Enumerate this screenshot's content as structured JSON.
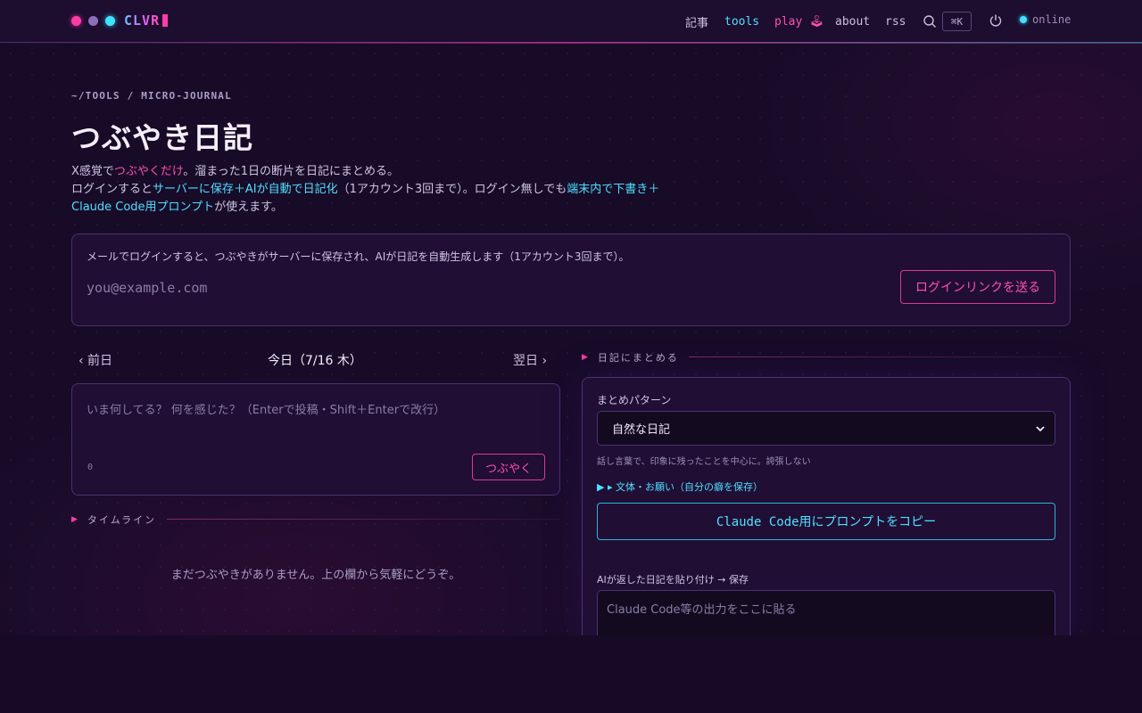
{
  "nav": {
    "logo": "CLVR",
    "articles": "記事",
    "tools": "tools",
    "play": "play 🕹",
    "about": "about",
    "rss": "rss",
    "search_shortcut": "⌘K",
    "status": "online",
    "icons": [
      "search-icon",
      "power-icon"
    ]
  },
  "header": {
    "breadcrumb": "~/TOOLS / MICRO-JOURNAL",
    "title": "つぶやき日記",
    "desc_1a": "X感覚で",
    "desc_1b": "つぶやくだけ",
    "desc_1c": "。溜まった1日の断片を日記にまとめる。",
    "desc_2a": "ログインすると",
    "desc_2b": "サーバーに保存＋AIが自動で日記化",
    "desc_2c": "（1アカウント3回まで）。ログイン無しでも",
    "desc_2d": "端末内で下書き＋Claude Code用プロンプト",
    "desc_2e": "が使えます。"
  },
  "login": {
    "note": "メールでログインすると、つぶやきがサーバーに保存され、AIが日記を自動生成します（1アカウント3回まで）。",
    "email_placeholder": "you@example.com",
    "button": "ログインリンクを送る"
  },
  "day_nav": {
    "prev": "‹  前日",
    "today": "今日（7/16 木）",
    "next": "翌日  ›"
  },
  "post": {
    "placeholder": "いま何してる？ 何を感じた？（Enterで投稿・Shift＋Enterで改行）",
    "count": "0",
    "button": "つぶやく"
  },
  "timeline": {
    "label": "タイムライン",
    "empty": "まだつぶやきがありません。上の欄から気軽にどうぞ。"
  },
  "summary": {
    "label": "日記にまとめる",
    "pattern_label": "まとめパターン",
    "pattern_value": "自然な日記",
    "pattern_hint": "話し言葉で、印象に残ったことを中心に。誇張しない",
    "style_toggle": "▶ ▸ 文体・お願い（自分の癖を保存）",
    "copy_button": "Claude Code用にプロンプトをコピー",
    "paste_label": "AIが返した日記を貼り付け → 保存",
    "paste_placeholder": "Claude Code等の出力をここに貼る"
  },
  "colors": {
    "accent_pink": "#ff4fb0",
    "accent_cyan": "#4ee0ff",
    "background": "#170a26"
  }
}
